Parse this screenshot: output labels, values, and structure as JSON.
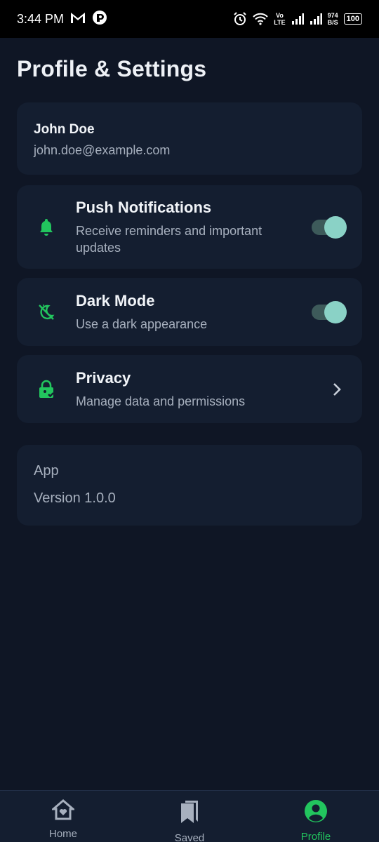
{
  "status_bar": {
    "time": "3:44 PM",
    "network_label_top": "Vo",
    "network_label_bottom": "LTE",
    "speed_value": "974",
    "speed_unit": "B/S",
    "battery": "100"
  },
  "page": {
    "title": "Profile & Settings"
  },
  "profile": {
    "name": "John Doe",
    "email": "john.doe@example.com"
  },
  "settings": [
    {
      "title": "Push Notifications",
      "description": "Receive reminders and important updates",
      "icon": "bell-icon",
      "enabled": true
    },
    {
      "title": "Dark Mode",
      "description": "Use a dark appearance",
      "icon": "dark-mode-icon",
      "enabled": true
    },
    {
      "title": "Privacy",
      "description": "Manage data and permissions",
      "icon": "lock-icon"
    }
  ],
  "app_info": {
    "label": "App",
    "version": "Version 1.0.0"
  },
  "bottom_nav": [
    {
      "label": "Home",
      "icon": "home-icon"
    },
    {
      "label": "Saved",
      "icon": "bookmark-icon"
    },
    {
      "label": "Profile",
      "icon": "profile-icon",
      "active": true
    }
  ],
  "colors": {
    "accent": "#22c55e",
    "background": "#0f1625",
    "card": "#141e30",
    "toggle_knob": "#8ad2c6"
  }
}
